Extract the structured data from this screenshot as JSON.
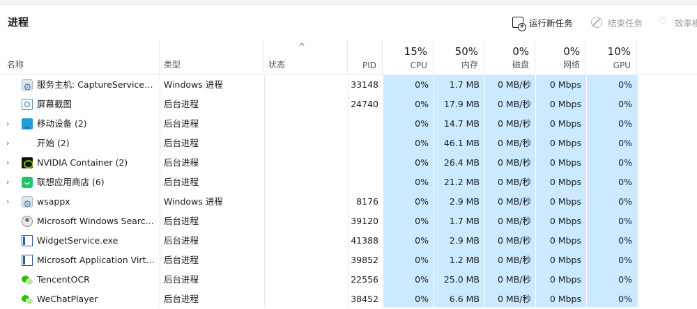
{
  "header": {
    "title": "进程",
    "run_task": "运行新任务",
    "end_task": "结束任务",
    "efficiency": "效率模"
  },
  "columns": {
    "name": "名称",
    "type": "类型",
    "status": "状态",
    "pid": "PID",
    "cpu": {
      "pct": "15%",
      "label": "CPU"
    },
    "mem": {
      "pct": "50%",
      "label": "内存"
    },
    "disk": {
      "pct": "0%",
      "label": "磁盘"
    },
    "net": {
      "pct": "0%",
      "label": "网络"
    },
    "gpu": {
      "pct": "10%",
      "label": "GPU"
    },
    "sort_indicator": "^"
  },
  "colors": {
    "heat_cell": "#cbeaff"
  },
  "rows": [
    {
      "chev": "",
      "icon": "gear-icon",
      "name": "服务主机: CaptureService_1...",
      "type": "Windows 进程",
      "pid": "33148",
      "cpu": "0%",
      "mem": "1.7 MB",
      "disk": "0 MB/秒",
      "net": "0 Mbps",
      "gpu": "0%"
    },
    {
      "chev": "",
      "icon": "snipping-tool-icon",
      "name": "屏幕截图",
      "type": "后台进程",
      "pid": "24740",
      "cpu": "0%",
      "mem": "17.9 MB",
      "disk": "0 MB/秒",
      "net": "0 Mbps",
      "gpu": "0%"
    },
    {
      "chev": "›",
      "icon": "mobile-device-icon",
      "name": "移动设备 (2)",
      "type": "后台进程",
      "pid": "",
      "cpu": "0%",
      "mem": "14.7 MB",
      "disk": "0 MB/秒",
      "net": "0 Mbps",
      "gpu": "0%"
    },
    {
      "chev": "›",
      "icon": "",
      "name": "开始 (2)",
      "type": "后台进程",
      "pid": "",
      "cpu": "0%",
      "mem": "46.1 MB",
      "disk": "0 MB/秒",
      "net": "0 Mbps",
      "gpu": "0%"
    },
    {
      "chev": "›",
      "icon": "nvidia-icon",
      "name": "NVIDIA Container (2)",
      "type": "后台进程",
      "pid": "",
      "cpu": "0%",
      "mem": "26.4 MB",
      "disk": "0 MB/秒",
      "net": "0 Mbps",
      "gpu": "0%"
    },
    {
      "chev": "›",
      "icon": "lenovo-store-icon",
      "name": "联想应用商店 (6)",
      "type": "后台进程",
      "pid": "",
      "cpu": "0%",
      "mem": "21.2 MB",
      "disk": "0 MB/秒",
      "net": "0 Mbps",
      "gpu": "0%"
    },
    {
      "chev": "›",
      "icon": "gear-icon",
      "name": "wsappx",
      "type": "Windows 进程",
      "pid": "8176",
      "cpu": "0%",
      "mem": "2.9 MB",
      "disk": "0 MB/秒",
      "net": "0 Mbps",
      "gpu": "0%"
    },
    {
      "chev": "",
      "icon": "search-user-icon",
      "name": "Microsoft Windows Search ...",
      "type": "后台进程",
      "pid": "39120",
      "cpu": "0%",
      "mem": "1.7 MB",
      "disk": "0 MB/秒",
      "net": "0 Mbps",
      "gpu": "0%"
    },
    {
      "chev": "",
      "icon": "app-window-icon",
      "name": "WidgetService.exe",
      "type": "后台进程",
      "pid": "41388",
      "cpu": "0%",
      "mem": "2.9 MB",
      "disk": "0 MB/秒",
      "net": "0 Mbps",
      "gpu": "0%"
    },
    {
      "chev": "",
      "icon": "app-window-icon",
      "name": "Microsoft Application Virtu...",
      "type": "后台进程",
      "pid": "39852",
      "cpu": "0%",
      "mem": "1.2 MB",
      "disk": "0 MB/秒",
      "net": "0 Mbps",
      "gpu": "0%"
    },
    {
      "chev": "",
      "icon": "wechat-icon",
      "name": "TencentOCR",
      "type": "后台进程",
      "pid": "22556",
      "cpu": "0%",
      "mem": "25.0 MB",
      "disk": "0 MB/秒",
      "net": "0 Mbps",
      "gpu": "0%"
    },
    {
      "chev": "",
      "icon": "wechat-icon",
      "name": "WeChatPlayer",
      "type": "后台进程",
      "pid": "38452",
      "cpu": "0%",
      "mem": "6.6 MB",
      "disk": "0 MB/秒",
      "net": "0 Mbps",
      "gpu": "0%"
    }
  ]
}
